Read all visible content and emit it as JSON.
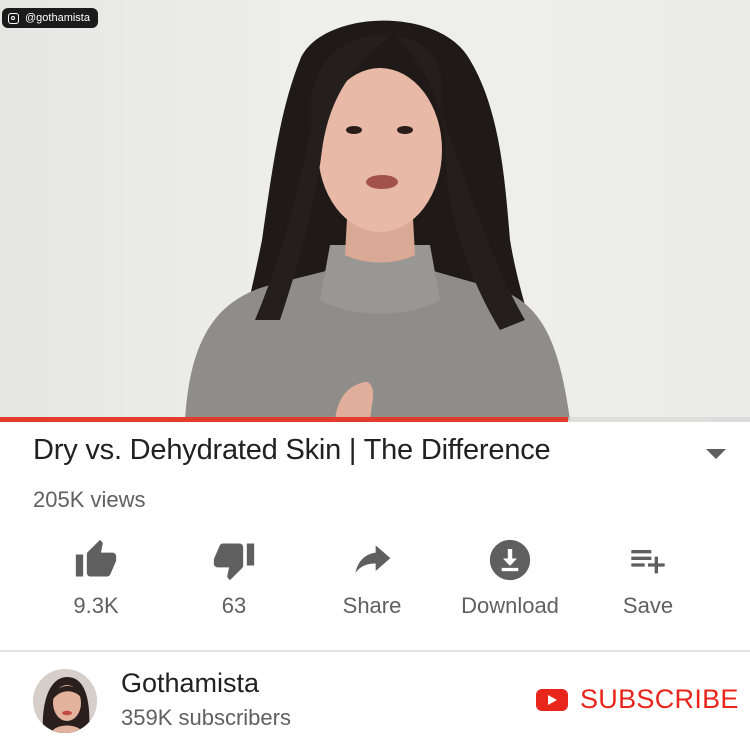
{
  "video": {
    "watermark": "@gothamista",
    "progress_fraction": 0.757
  },
  "title": "Dry vs. Dehydrated Skin | The Difference",
  "views": "205K views",
  "actions": {
    "like": "9.3K",
    "dislike": "63",
    "share": "Share",
    "download": "Download",
    "save": "Save"
  },
  "channel": {
    "name": "Gothamista",
    "subscribers": "359K subscribers"
  },
  "subscribe_label": "SUBSCRIBE",
  "colors": {
    "accent_red": "#e8261c",
    "progress_red": "#e33b2e",
    "icon_gray": "#5f5f5f",
    "text_secondary": "#606060"
  },
  "icons": [
    "instagram-icon",
    "thumbs-up-icon",
    "thumbs-down-icon",
    "share-arrow-icon",
    "download-icon",
    "playlist-add-icon",
    "youtube-play-icon"
  ]
}
